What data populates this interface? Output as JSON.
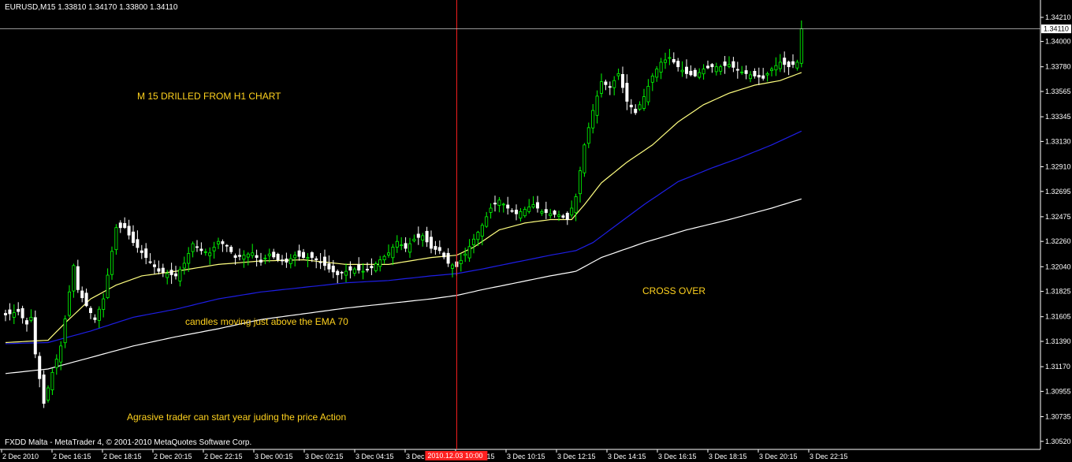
{
  "header": {
    "title": "EURUSD,M15  1.33810 1.34170 1.33800 1.34110"
  },
  "footer": {
    "text": "FXDD Malta - MetaTrader 4, © 2001-2010 MetaQuotes Software Corp."
  },
  "annotations": {
    "drilled": "M 15  DRILLED FROM H1 CHART",
    "candles": "candles moving just above the EMA 70",
    "cross": "CROSS OVER",
    "agrasive": "Agrasive trader can start year  juding the price Action"
  },
  "crosshair": {
    "time_label": "2010.12.03 10:00",
    "price_label": "1.34110"
  },
  "colors": {
    "background": "#000000",
    "bull_candle": "#00ff00",
    "bear_candle": "#ffffff",
    "ema_fast": "#ffff80",
    "ema_70": "#1e1ee6",
    "ema_slow": "#ffffff",
    "crosshair_v": "#ff2020",
    "crosshair_h": "#c8c8c8",
    "annotation_text": "#ffd21e",
    "axis": "#ffffff"
  },
  "chart_data": {
    "type": "candlestick",
    "symbol": "EURUSD",
    "timeframe": "M15",
    "ylim": [
      1.3045,
      1.3432
    ],
    "y_ticks": [
      "1.34210",
      "1.34000",
      "1.33780",
      "1.33565",
      "1.33345",
      "1.33130",
      "1.32910",
      "1.32695",
      "1.32475",
      "1.32260",
      "1.32040",
      "1.31825",
      "1.31605",
      "1.31390",
      "1.31170",
      "1.30955",
      "1.30735",
      "1.30520"
    ],
    "x_ticks": [
      "2 Dec 2010",
      "2 Dec 16:15",
      "2 Dec 18:15",
      "2 Dec 20:15",
      "2 Dec 22:15",
      "3 Dec 00:15",
      "3 Dec 02:15",
      "3 Dec 04:15",
      "3 Dec 06:15",
      "3 Dec 08:15",
      "3 Dec 10:15",
      "3 Dec 12:15",
      "3 Dec 14:15",
      "3 Dec 16:15",
      "3 Dec 18:15",
      "3 Dec 20:15",
      "3 Dec 22:15"
    ],
    "crosshair_price": 1.3411,
    "crosshair_index": 106,
    "close_anchors": [
      [
        0,
        1.3162
      ],
      [
        3,
        1.3165
      ],
      [
        5,
        1.3154
      ],
      [
        6,
        1.316
      ],
      [
        7,
        1.3128
      ],
      [
        9,
        1.3085
      ],
      [
        11,
        1.3112
      ],
      [
        13,
        1.3135
      ],
      [
        15,
        1.3182
      ],
      [
        16,
        1.3205
      ],
      [
        17,
        1.3184
      ],
      [
        19,
        1.317
      ],
      [
        21,
        1.3158
      ],
      [
        23,
        1.3176
      ],
      [
        26,
        1.3238
      ],
      [
        28,
        1.3238
      ],
      [
        30,
        1.3225
      ],
      [
        33,
        1.3212
      ],
      [
        36,
        1.32
      ],
      [
        38,
        1.3198
      ],
      [
        40,
        1.3196
      ],
      [
        42,
        1.3207
      ],
      [
        44,
        1.3224
      ],
      [
        46,
        1.3218
      ],
      [
        48,
        1.3216
      ],
      [
        50,
        1.3226
      ],
      [
        52,
        1.3222
      ],
      [
        54,
        1.3212
      ],
      [
        56,
        1.3214
      ],
      [
        58,
        1.3216
      ],
      [
        60,
        1.3208
      ],
      [
        62,
        1.3215
      ],
      [
        64,
        1.321
      ],
      [
        66,
        1.3208
      ],
      [
        68,
        1.3214
      ],
      [
        70,
        1.3212
      ],
      [
        72,
        1.3212
      ],
      [
        74,
        1.3208
      ],
      [
        76,
        1.3202
      ],
      [
        78,
        1.3197
      ],
      [
        80,
        1.32
      ],
      [
        82,
        1.3202
      ],
      [
        84,
        1.32
      ],
      [
        86,
        1.3203
      ],
      [
        88,
        1.321
      ],
      [
        90,
        1.3216
      ],
      [
        92,
        1.3226
      ],
      [
        94,
        1.322
      ],
      [
        96,
        1.3228
      ],
      [
        98,
        1.3231
      ],
      [
        100,
        1.322
      ],
      [
        102,
        1.3218
      ],
      [
        104,
        1.3207
      ],
      [
        106,
        1.3204
      ],
      [
        108,
        1.3215
      ],
      [
        110,
        1.3228
      ],
      [
        112,
        1.324
      ],
      [
        114,
        1.3255
      ],
      [
        116,
        1.3262
      ],
      [
        118,
        1.3255
      ],
      [
        120,
        1.325
      ],
      [
        122,
        1.3254
      ],
      [
        124,
        1.3258
      ],
      [
        126,
        1.3252
      ],
      [
        128,
        1.325
      ],
      [
        130,
        1.3249
      ],
      [
        132,
        1.3245
      ],
      [
        134,
        1.3265
      ],
      [
        136,
        1.331
      ],
      [
        138,
        1.334
      ],
      [
        140,
        1.3365
      ],
      [
        142,
        1.336
      ],
      [
        144,
        1.3372
      ],
      [
        146,
        1.3348
      ],
      [
        148,
        1.3338
      ],
      [
        150,
        1.3352
      ],
      [
        152,
        1.337
      ],
      [
        154,
        1.3382
      ],
      [
        156,
        1.3386
      ],
      [
        158,
        1.3378
      ],
      [
        160,
        1.3372
      ],
      [
        162,
        1.337
      ],
      [
        164,
        1.3376
      ],
      [
        166,
        1.3378
      ],
      [
        168,
        1.3378
      ],
      [
        170,
        1.338
      ],
      [
        172,
        1.3375
      ],
      [
        174,
        1.3372
      ],
      [
        176,
        1.337
      ],
      [
        178,
        1.3368
      ],
      [
        180,
        1.3376
      ],
      [
        182,
        1.3382
      ],
      [
        184,
        1.3378
      ],
      [
        186,
        1.3382
      ],
      [
        187,
        1.3411
      ]
    ],
    "ema_fast_anchors": [
      [
        0,
        1.3138
      ],
      [
        10,
        1.314
      ],
      [
        14,
        1.3155
      ],
      [
        20,
        1.3176
      ],
      [
        26,
        1.3188
      ],
      [
        32,
        1.3196
      ],
      [
        40,
        1.32
      ],
      [
        50,
        1.3206
      ],
      [
        60,
        1.3209
      ],
      [
        70,
        1.321
      ],
      [
        80,
        1.3206
      ],
      [
        90,
        1.3206
      ],
      [
        100,
        1.3212
      ],
      [
        106,
        1.3214
      ],
      [
        110,
        1.3221
      ],
      [
        116,
        1.3236
      ],
      [
        122,
        1.3242
      ],
      [
        128,
        1.3245
      ],
      [
        133,
        1.3245
      ],
      [
        136,
        1.3258
      ],
      [
        140,
        1.3277
      ],
      [
        146,
        1.3295
      ],
      [
        152,
        1.331
      ],
      [
        158,
        1.333
      ],
      [
        164,
        1.3345
      ],
      [
        170,
        1.3355
      ],
      [
        176,
        1.3362
      ],
      [
        182,
        1.3366
      ],
      [
        187,
        1.3373
      ]
    ],
    "ema70_anchors": [
      [
        0,
        1.3137
      ],
      [
        10,
        1.3138
      ],
      [
        20,
        1.3148
      ],
      [
        30,
        1.316
      ],
      [
        40,
        1.3167
      ],
      [
        50,
        1.3176
      ],
      [
        60,
        1.3182
      ],
      [
        70,
        1.3186
      ],
      [
        80,
        1.319
      ],
      [
        90,
        1.3192
      ],
      [
        100,
        1.3196
      ],
      [
        106,
        1.3198
      ],
      [
        112,
        1.3202
      ],
      [
        120,
        1.3208
      ],
      [
        128,
        1.3214
      ],
      [
        134,
        1.3218
      ],
      [
        138,
        1.3225
      ],
      [
        142,
        1.3236
      ],
      [
        150,
        1.3258
      ],
      [
        158,
        1.3278
      ],
      [
        166,
        1.329
      ],
      [
        172,
        1.3298
      ],
      [
        180,
        1.331
      ],
      [
        187,
        1.3322
      ]
    ],
    "ema_slow_anchors": [
      [
        0,
        1.3111
      ],
      [
        10,
        1.3115
      ],
      [
        20,
        1.3125
      ],
      [
        30,
        1.3135
      ],
      [
        40,
        1.3143
      ],
      [
        50,
        1.315
      ],
      [
        60,
        1.3158
      ],
      [
        70,
        1.3163
      ],
      [
        80,
        1.3168
      ],
      [
        90,
        1.3172
      ],
      [
        100,
        1.3176
      ],
      [
        106,
        1.3179
      ],
      [
        112,
        1.3184
      ],
      [
        120,
        1.319
      ],
      [
        128,
        1.3196
      ],
      [
        134,
        1.32
      ],
      [
        140,
        1.3212
      ],
      [
        150,
        1.3225
      ],
      [
        160,
        1.3236
      ],
      [
        170,
        1.3245
      ],
      [
        180,
        1.3255
      ],
      [
        187,
        1.3263
      ]
    ]
  }
}
